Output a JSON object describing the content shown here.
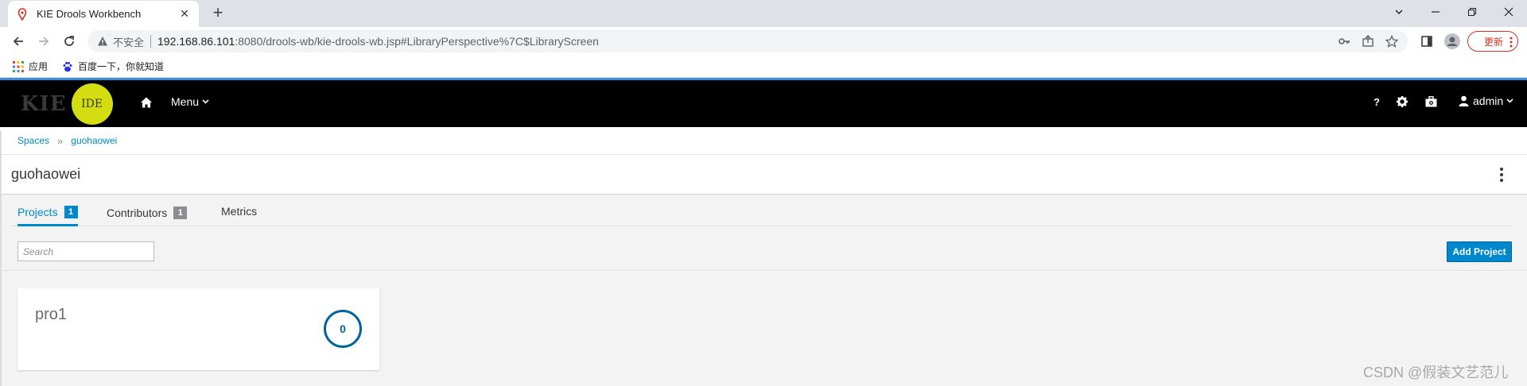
{
  "browser": {
    "tab_title": "KIE Drools Workbench",
    "security_label": "不安全",
    "url_host": "192.168.86.101",
    "url_rest": ":8080/drools-wb/kie-drools-wb.jsp#LibraryPerspective%7C$LibraryScreen",
    "update_label": "更新",
    "bookmarks": [
      {
        "label": "应用",
        "icon": "apps-grid-icon"
      },
      {
        "label": "百度一下，你就知道",
        "icon": "baidu-paw-icon"
      }
    ]
  },
  "navbar": {
    "logo_text": "KIE",
    "logo_badge": "IDE",
    "menu_label": "Menu",
    "help_label": "?",
    "user_label": "admin"
  },
  "breadcrumb": {
    "items": [
      "Spaces",
      "guohaowei"
    ],
    "separator": "»"
  },
  "space": {
    "title": "guohaowei"
  },
  "tabs": [
    {
      "label": "Projects",
      "count": "1",
      "active": true
    },
    {
      "label": "Contributors",
      "count": "1",
      "active": false
    },
    {
      "label": "Metrics",
      "count": "",
      "active": false
    }
  ],
  "search": {
    "placeholder": "Search",
    "value": ""
  },
  "actions": {
    "add_project_label": "Add Project"
  },
  "projects": [
    {
      "name": "pro1",
      "count": "0"
    }
  ],
  "watermark": "CSDN @假装文艺范儿",
  "colors": {
    "accent": "#0088ce",
    "navbar_bg": "#000000",
    "logo_circle": "#d4dd10",
    "count_ring": "#00659c"
  }
}
